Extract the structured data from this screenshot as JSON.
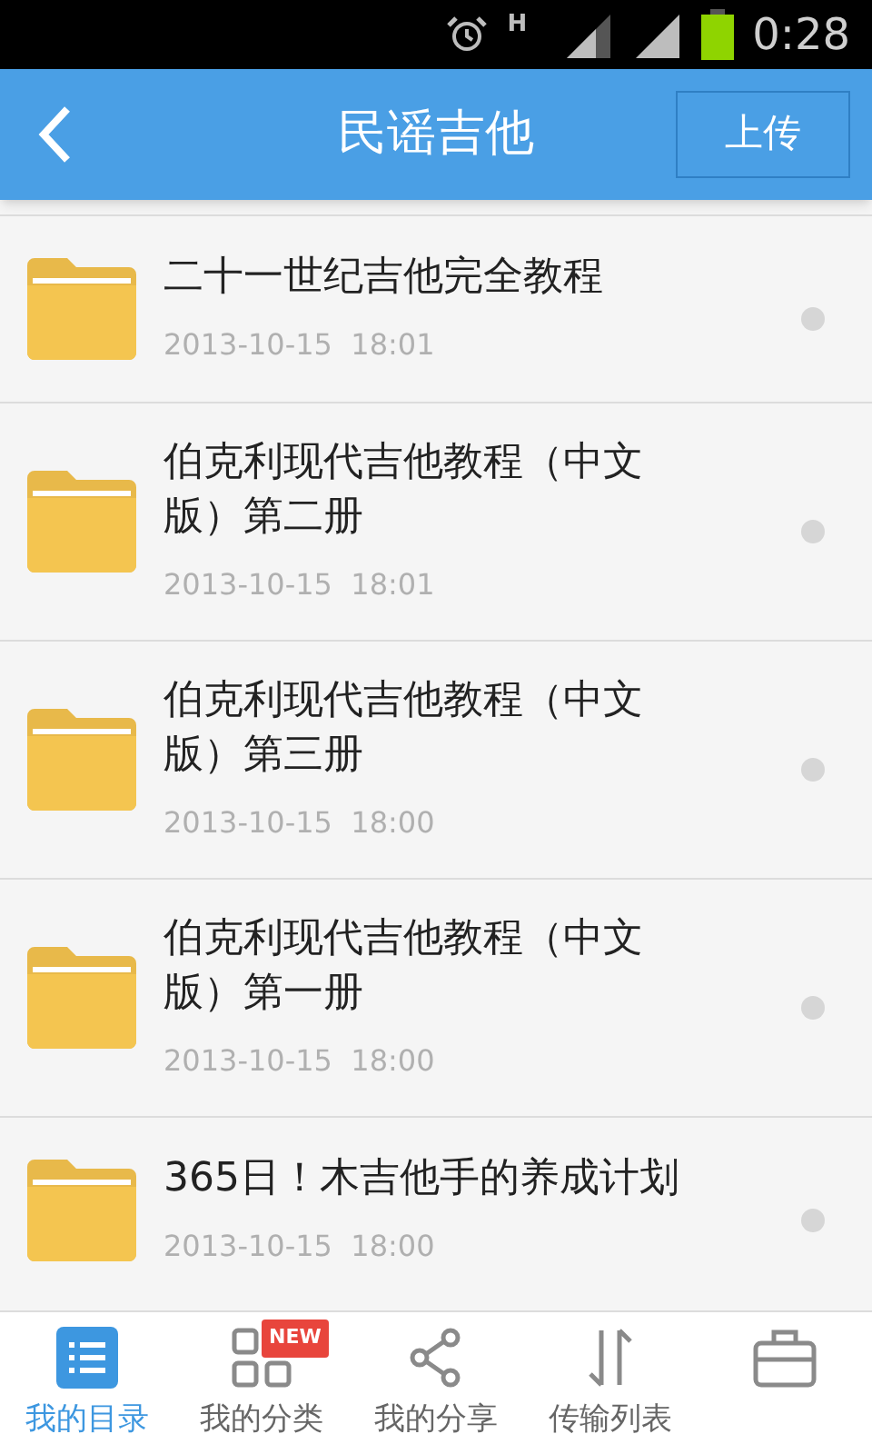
{
  "status_bar": {
    "network": "H",
    "time": "0:28"
  },
  "header": {
    "title": "民谣吉他",
    "upload_button": "上传"
  },
  "files": [
    {
      "name": "二十一世纪吉他完全教程",
      "date": "2013-10-15  18:01"
    },
    {
      "name": "伯克利现代吉他教程（中文版）第二册",
      "date": "2013-10-15  18:01"
    },
    {
      "name": "伯克利现代吉他教程（中文版）第三册",
      "date": "2013-10-15  18:00"
    },
    {
      "name": "伯克利现代吉他教程（中文版）第一册",
      "date": "2013-10-15  18:00"
    },
    {
      "name": "365日！木吉他手的养成计划",
      "date": "2013-10-15  18:00"
    }
  ],
  "tabs": [
    {
      "kind": "list",
      "label": "我的目录",
      "selected": true
    },
    {
      "kind": "grid",
      "label": "我的分类",
      "badge": "NEW",
      "selected": false
    },
    {
      "kind": "share",
      "label": "我的分享",
      "selected": false
    },
    {
      "kind": "transfer",
      "label": "传输列表",
      "selected": false
    },
    {
      "kind": "case",
      "selected": false
    }
  ]
}
